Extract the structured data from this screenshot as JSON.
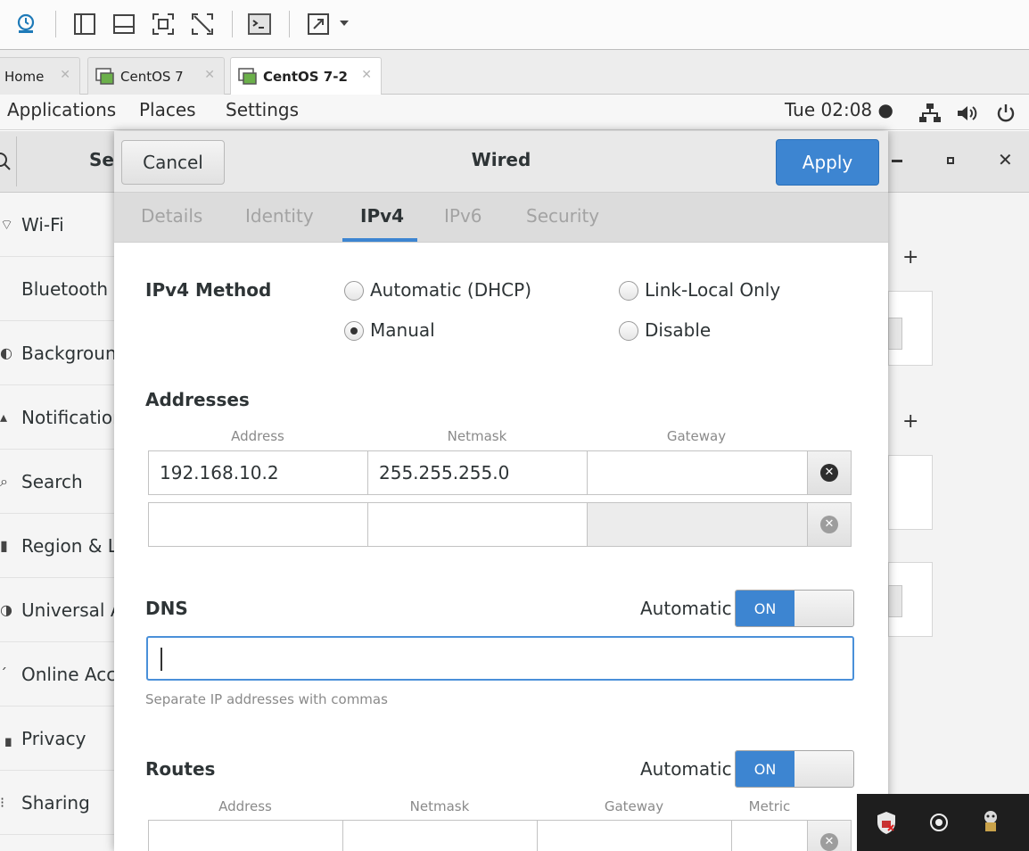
{
  "vm_tabs": [
    {
      "label": "Home"
    },
    {
      "label": "CentOS 7"
    },
    {
      "label": "CentOS 7-2"
    }
  ],
  "gnome_bar": {
    "applications": "Applications",
    "places": "Places",
    "settings": "Settings",
    "clock": "Tue 02:08 ●"
  },
  "settings": {
    "search_title_partial": "Se",
    "sidebar": [
      {
        "label": "Wi-Fi",
        "icon": "wifi-icon"
      },
      {
        "label": "Bluetooth",
        "icon": "bluetooth-icon"
      },
      {
        "label": "Background",
        "icon": "background-icon"
      },
      {
        "label": "Notifications",
        "icon": "notification-icon"
      },
      {
        "label": "Search",
        "icon": "search-icon"
      },
      {
        "label": "Region & Language",
        "icon": "region-icon"
      },
      {
        "label": "Universal Access",
        "icon": "accessibility-icon"
      },
      {
        "label": "Online Accounts",
        "icon": "online-accounts-icon"
      },
      {
        "label": "Privacy",
        "icon": "privacy-icon"
      },
      {
        "label": "Sharing",
        "icon": "sharing-icon"
      }
    ]
  },
  "dialog": {
    "title": "Wired",
    "cancel": "Cancel",
    "apply": "Apply",
    "tabs": [
      "Details",
      "Identity",
      "IPv4",
      "IPv6",
      "Security"
    ],
    "active_tab": "IPv4",
    "ipv4_method_label": "IPv4 Method",
    "methods": {
      "auto": "Automatic (DHCP)",
      "link_local": "Link-Local Only",
      "manual": "Manual",
      "disable": "Disable"
    },
    "selected_method": "Manual",
    "addresses": {
      "heading": "Addresses",
      "columns": [
        "Address",
        "Netmask",
        "Gateway"
      ],
      "rows": [
        {
          "address": "192.168.10.2",
          "netmask": "255.255.255.0",
          "gateway": ""
        },
        {
          "address": "",
          "netmask": "",
          "gateway": ""
        }
      ]
    },
    "dns": {
      "heading": "DNS",
      "auto_label": "Automatic",
      "switch": "ON",
      "value": "",
      "hint": "Separate IP addresses with commas"
    },
    "routes": {
      "heading": "Routes",
      "auto_label": "Automatic",
      "switch": "ON",
      "columns": [
        "Address",
        "Netmask",
        "Gateway",
        "Metric"
      ]
    }
  },
  "colors": {
    "accent": "#3d85d1",
    "header_bg": "#e9e9e9"
  }
}
